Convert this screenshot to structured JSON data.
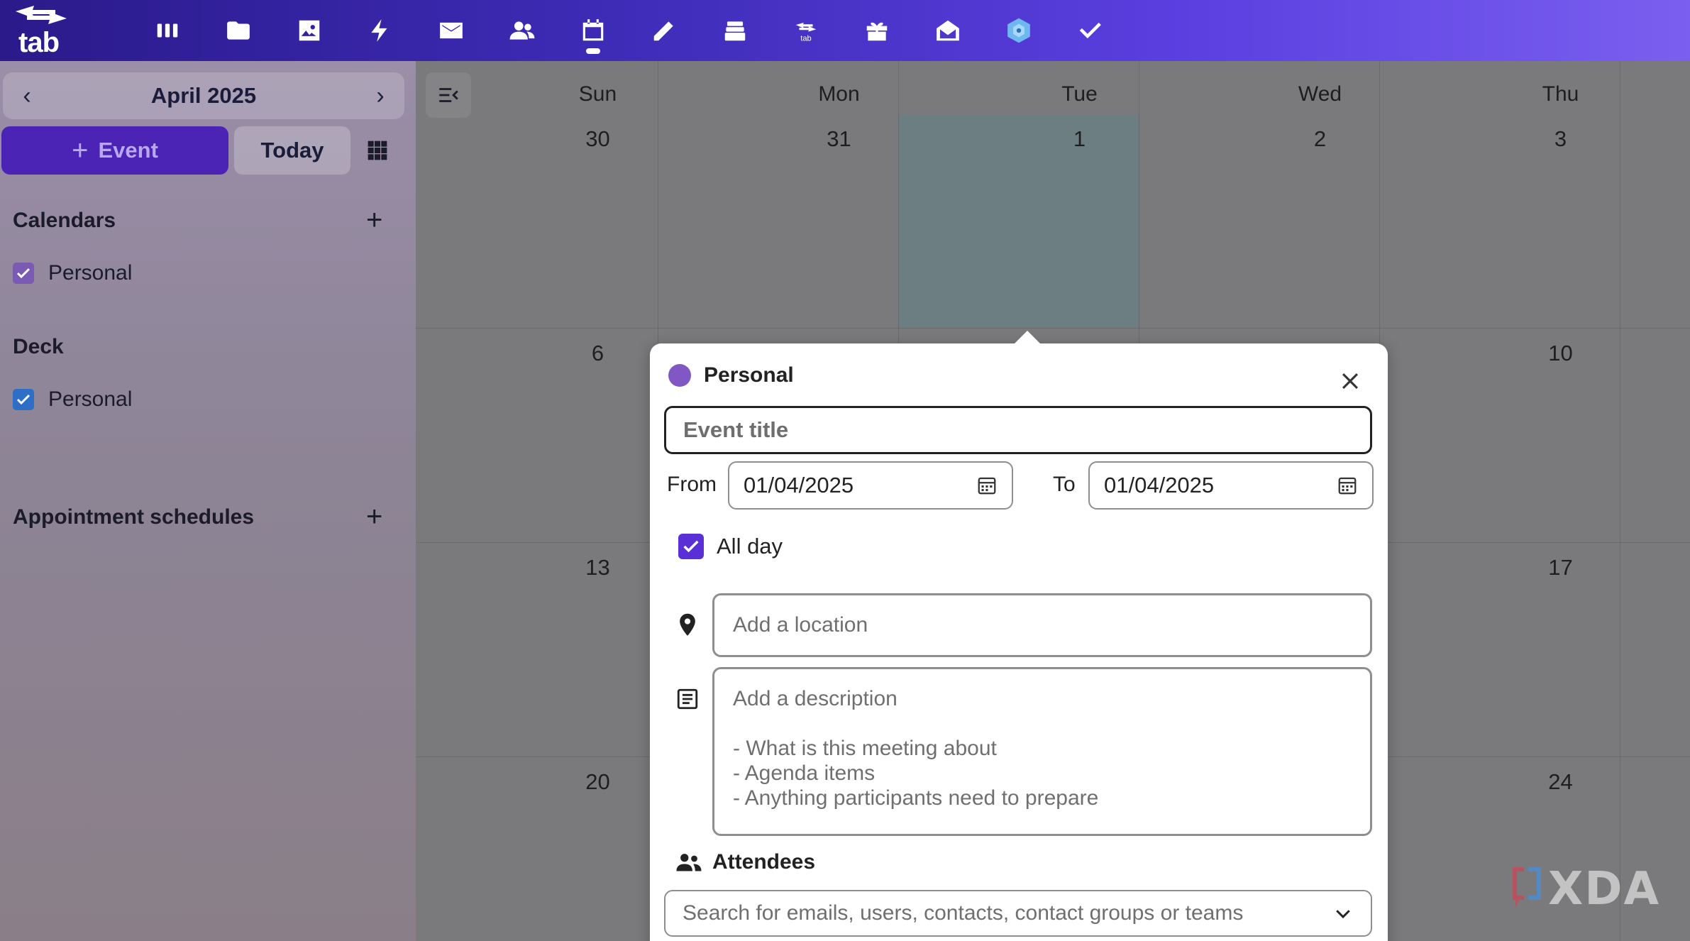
{
  "topbar": {
    "logo_text": "tab",
    "apps": [
      {
        "icon": "dashboard-icon",
        "active": false
      },
      {
        "icon": "files-icon",
        "active": false
      },
      {
        "icon": "photos-icon",
        "active": false
      },
      {
        "icon": "activity-icon",
        "active": false
      },
      {
        "icon": "mail-icon",
        "active": false
      },
      {
        "icon": "contacts-icon",
        "active": false
      },
      {
        "icon": "calendar-icon",
        "active": true
      },
      {
        "icon": "notes-icon",
        "active": false
      },
      {
        "icon": "deck-icon",
        "active": false
      },
      {
        "icon": "tab-app-icon",
        "active": false
      },
      {
        "icon": "gift-icon",
        "active": false
      },
      {
        "icon": "open-mail-icon",
        "active": false
      },
      {
        "icon": "hexagon-app-icon",
        "active": false
      },
      {
        "icon": "tasks-check-icon",
        "active": false
      }
    ]
  },
  "sidebar": {
    "month_label": "April 2025",
    "new_event_label": "Event",
    "today_label": "Today",
    "calendars_heading": "Calendars",
    "calendars": [
      {
        "label": "Personal",
        "color": "#7a5ab3"
      }
    ],
    "deck_heading": "Deck",
    "deck_items": [
      {
        "label": "Personal",
        "color": "#2d6fc7"
      }
    ],
    "appointments_heading": "Appointment schedules"
  },
  "calendar": {
    "day_names": [
      "Sun",
      "Mon",
      "Tue",
      "Wed",
      "Thu"
    ],
    "weeks": [
      [
        "30",
        "31",
        "1",
        "2",
        "3"
      ],
      [
        "6",
        "",
        "",
        "",
        "10"
      ],
      [
        "13",
        "",
        "",
        "",
        "17"
      ],
      [
        "20",
        "",
        "",
        "",
        "24"
      ]
    ],
    "today_color": "#6d7e82"
  },
  "popover": {
    "calendar_name": "Personal",
    "calendar_color": "#8057c4",
    "title_placeholder": "Event title",
    "from_label": "From",
    "from_value": "01/04/2025",
    "to_label": "To",
    "to_value": "01/04/2025",
    "all_day_label": "All day",
    "all_day_checked": true,
    "location_placeholder": "Add a location",
    "description_placeholder": "Add a description\n\n- What is this meeting about\n- Agenda items\n- Anything participants need to prepare",
    "attendees_heading": "Attendees",
    "attendees_placeholder": "Search for emails, users, contacts, contact groups or teams"
  },
  "watermark": {
    "text": "XDA"
  },
  "colors": {
    "accent": "#4b23b5",
    "checkbox": "#5b2fd6"
  }
}
